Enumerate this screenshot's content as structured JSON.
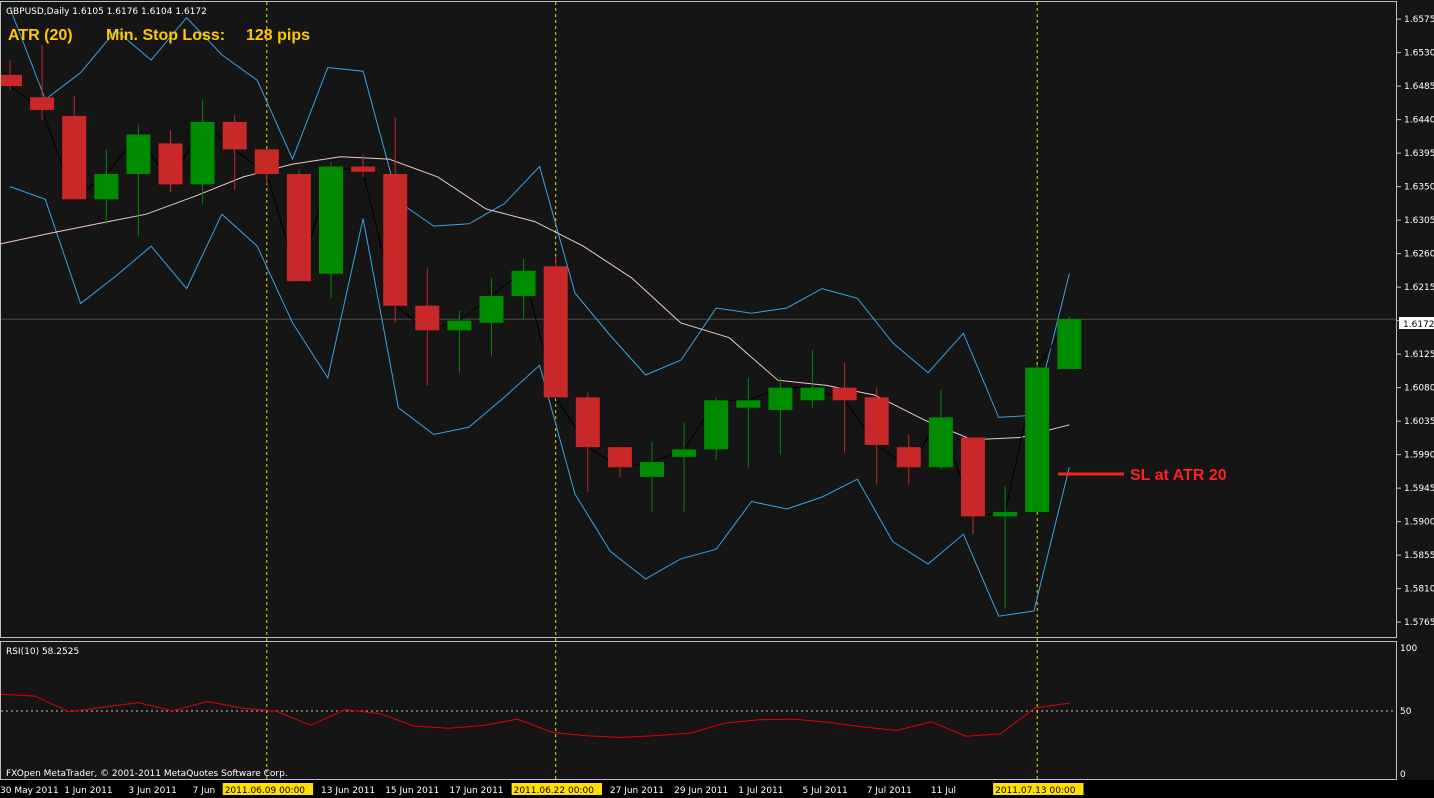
{
  "header": {
    "symbol_info": "GBPUSD,Daily  1.6105 1.6176 1.6104 1.6172",
    "atr_label": "ATR (20)",
    "stop_loss_label": "Min. Stop Loss:",
    "stop_loss_value": "128 pips"
  },
  "footer": {
    "copyright": "FXOpen MetaTrader, © 2001-2011 MetaQuotes Software Corp."
  },
  "colors": {
    "background": "#151515",
    "grid_frame": "#c0c0c0",
    "bull": "#008c00",
    "bear": "#c82828",
    "band": "#36a2e8",
    "ma": "#f0c8c8",
    "close_line": "#000000",
    "rsi": "#e00000",
    "vline": "#e8e000",
    "annotation_yellow": "#ffc800",
    "annotation_red": "#ff2020"
  },
  "chart_data": [
    {
      "type": "candlestick",
      "title": "GBPUSD,Daily",
      "ylim": [
        1.5745,
        1.6598
      ],
      "y_ticks": [
        "1.6575",
        "1.6530",
        "1.6485",
        "1.6440",
        "1.6395",
        "1.6350",
        "1.6305",
        "1.6260",
        "1.6215",
        "1.6170",
        "1.6125",
        "1.6080",
        "1.6035",
        "1.5990",
        "1.5945",
        "1.5900",
        "1.5855",
        "1.5810",
        "1.5765"
      ],
      "current_price": "1.6172",
      "x_labels": [
        "30 May 2011",
        "1 Jun 2011",
        "3 Jun 2011",
        "7 Jun",
        "2011.06.09 00:00",
        "13 Jun 2011",
        "15 Jun 2011",
        "17 Jun 2011",
        "2011.06.22 00:00",
        "27 Jun 2011",
        "29 Jun 2011",
        "1 Jul 2011",
        "5 Jul 2011",
        "7 Jul 2011",
        "11 Jul",
        "2011.07.13 00:00"
      ],
      "highlighted_dates": [
        "2011.06.09 00:00",
        "2011.06.22 00:00",
        "2011.07.13 00:00"
      ],
      "candles": [
        {
          "o": 1.65,
          "h": 1.652,
          "l": 1.648,
          "c": 1.6485
        },
        {
          "o": 1.647,
          "h": 1.654,
          "l": 1.644,
          "c": 1.6453
        },
        {
          "o": 1.6445,
          "h": 1.6472,
          "l": 1.6333,
          "c": 1.6333
        },
        {
          "o": 1.6333,
          "h": 1.64,
          "l": 1.63,
          "c": 1.6367
        },
        {
          "o": 1.6367,
          "h": 1.6433,
          "l": 1.6283,
          "c": 1.642
        },
        {
          "o": 1.6408,
          "h": 1.6425,
          "l": 1.6343,
          "c": 1.6353
        },
        {
          "o": 1.6353,
          "h": 1.6467,
          "l": 1.6327,
          "c": 1.6437
        },
        {
          "o": 1.6437,
          "h": 1.6446,
          "l": 1.6346,
          "c": 1.64
        },
        {
          "o": 1.64,
          "h": 1.64,
          "l": 1.6353,
          "c": 1.6367
        },
        {
          "o": 1.6367,
          "h": 1.6373,
          "l": 1.6223,
          "c": 1.6223
        },
        {
          "o": 1.6233,
          "h": 1.6383,
          "l": 1.62,
          "c": 1.6377
        },
        {
          "o": 1.6377,
          "h": 1.6393,
          "l": 1.6363,
          "c": 1.637
        },
        {
          "o": 1.6367,
          "h": 1.6443,
          "l": 1.6167,
          "c": 1.619
        },
        {
          "o": 1.619,
          "h": 1.624,
          "l": 1.6083,
          "c": 1.6157
        },
        {
          "o": 1.6157,
          "h": 1.6183,
          "l": 1.61,
          "c": 1.617
        },
        {
          "o": 1.6167,
          "h": 1.6227,
          "l": 1.6123,
          "c": 1.6203
        },
        {
          "o": 1.6203,
          "h": 1.6253,
          "l": 1.6173,
          "c": 1.6237
        },
        {
          "o": 1.6243,
          "h": 1.6257,
          "l": 1.6067,
          "c": 1.6067
        },
        {
          "o": 1.6067,
          "h": 1.6073,
          "l": 1.594,
          "c": 1.6
        },
        {
          "o": 1.6,
          "h": 1.6,
          "l": 1.596,
          "c": 1.5973
        },
        {
          "o": 1.596,
          "h": 1.6007,
          "l": 1.5913,
          "c": 1.598
        },
        {
          "o": 1.5987,
          "h": 1.6033,
          "l": 1.5913,
          "c": 1.5997
        },
        {
          "o": 1.5997,
          "h": 1.6067,
          "l": 1.5983,
          "c": 1.6063
        },
        {
          "o": 1.6053,
          "h": 1.6093,
          "l": 1.5973,
          "c": 1.6063
        },
        {
          "o": 1.605,
          "h": 1.6093,
          "l": 1.599,
          "c": 1.608
        },
        {
          "o": 1.6063,
          "h": 1.613,
          "l": 1.6053,
          "c": 1.608
        },
        {
          "o": 1.608,
          "h": 1.6113,
          "l": 1.5993,
          "c": 1.6063
        },
        {
          "o": 1.6067,
          "h": 1.608,
          "l": 1.595,
          "c": 1.6003
        },
        {
          "o": 1.6,
          "h": 1.6017,
          "l": 1.595,
          "c": 1.5973
        },
        {
          "o": 1.5973,
          "h": 1.6077,
          "l": 1.597,
          "c": 1.604
        },
        {
          "o": 1.6013,
          "h": 1.6013,
          "l": 1.5883,
          "c": 1.5907
        },
        {
          "o": 1.5907,
          "h": 1.5947,
          "l": 1.5783,
          "c": 1.5913
        },
        {
          "o": 1.5913,
          "h": 1.611,
          "l": 1.5913,
          "c": 1.6107
        },
        {
          "o": 1.6105,
          "h": 1.6176,
          "l": 1.6104,
          "c": 1.6172
        }
      ],
      "upper_band": [
        1.659,
        1.6467,
        1.6503,
        1.656,
        1.652,
        1.6577,
        1.6527,
        1.6493,
        1.6387,
        1.651,
        1.6505,
        1.633,
        1.6297,
        1.63,
        1.6327,
        1.6377,
        1.6207,
        1.615,
        1.6097,
        1.6117,
        1.6187,
        1.618,
        1.6187,
        1.6213,
        1.62,
        1.614,
        1.61,
        1.6153,
        1.604,
        1.6043,
        1.6233
      ],
      "upper_band_x": [
        0,
        3,
        5,
        8,
        10,
        12,
        13,
        15,
        16,
        17,
        18,
        19,
        20,
        21,
        22,
        23,
        24,
        25,
        26,
        27,
        28,
        29,
        30,
        31,
        32,
        26,
        27,
        28,
        29,
        30,
        31
      ],
      "moving_average": [
        1.6273,
        1.6287,
        1.63,
        1.6313,
        1.6337,
        1.6363,
        1.638,
        1.639,
        1.6387,
        1.6363,
        1.632,
        1.6303,
        1.627,
        1.6227,
        1.6167,
        1.6147,
        1.609,
        1.6083,
        1.607,
        1.6037,
        1.601,
        1.6013,
        1.603
      ],
      "rsi": [
        63.3,
        61.8,
        49.3,
        53.1,
        56.7,
        50.2,
        57.5,
        52.4,
        49.8,
        38.7,
        51.0,
        48.0,
        38.0,
        36.3,
        38.5,
        43.6,
        33.0,
        30.3,
        29.0,
        30.5,
        32.4,
        40.2,
        43.0,
        43.6,
        41.1,
        37.4,
        34.6,
        41.4,
        30.0,
        31.8,
        52.4,
        56.3
      ],
      "indicator": {
        "label": "RSI(10) 58.2525",
        "ylim": [
          0,
          100
        ],
        "y_ticks": [
          "100",
          "50",
          "0"
        ],
        "level": 50
      },
      "annotations": {
        "stop_loss_marker": "SL at ATR 20",
        "stop_loss_price": 1.5973
      }
    }
  ]
}
